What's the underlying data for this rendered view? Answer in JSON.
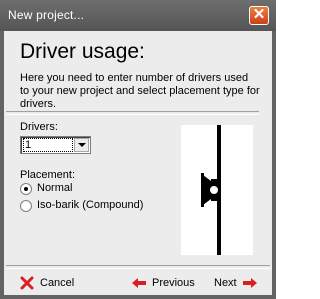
{
  "window": {
    "title": "New project...",
    "close_icon": "close-icon"
  },
  "header": {
    "title": "Driver usage:",
    "description": "Here you need to enter number of drivers used to your new project and select placement type for drivers."
  },
  "drivers": {
    "label": "Drivers:",
    "selected": "1"
  },
  "placement": {
    "label": "Placement:",
    "options": [
      {
        "label": "Normal",
        "checked": true
      },
      {
        "label": "Iso-barik (Compound)",
        "checked": false
      }
    ]
  },
  "preview": {
    "icon": "driver-baffle-icon"
  },
  "buttons": {
    "cancel": "Cancel",
    "previous": "Previous",
    "next": "Next"
  },
  "colors": {
    "titlebar": "#636363",
    "close_button": "#d9542a",
    "nav_arrow": "#d92020"
  }
}
